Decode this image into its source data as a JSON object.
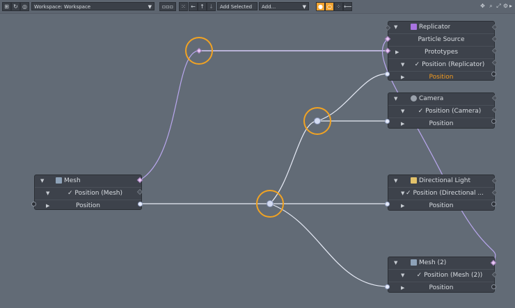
{
  "toolbar": {
    "workspace_select": "Workspace: Workspace",
    "add_selected_label": "Add Selected",
    "add_menu_label": "Add..."
  },
  "nodes": {
    "replicator": {
      "title": "Replicator",
      "rows": [
        "Particle Source",
        "Prototypes",
        "Position (Replicator)",
        "Position"
      ]
    },
    "camera": {
      "title": "Camera",
      "rows": [
        "Position (Camera)",
        "Position"
      ]
    },
    "mesh": {
      "title": "Mesh",
      "rows": [
        "Position (Mesh)",
        "Position"
      ]
    },
    "dirlight": {
      "title": "Directional Light",
      "rows": [
        "Position (Directional ...",
        "Position"
      ]
    },
    "mesh2": {
      "title": "Mesh (2)",
      "rows": [
        "Position (Mesh (2))",
        "Position"
      ]
    }
  },
  "colors": {
    "background": "#626b76",
    "node_body": "#3d424b",
    "wire": "#b9a7ee",
    "wire_white": "#e8ecf7",
    "highlight_ring": "#f1a323",
    "orange_label": "#f39a1e",
    "replicator_icon": "#a874e0"
  },
  "icons": [
    "workspace-icon",
    "graph-icon",
    "layout-icon",
    "arrow-left-icon",
    "arrow-up-icon",
    "arrow-down-icon",
    "zoom-icon"
  ]
}
